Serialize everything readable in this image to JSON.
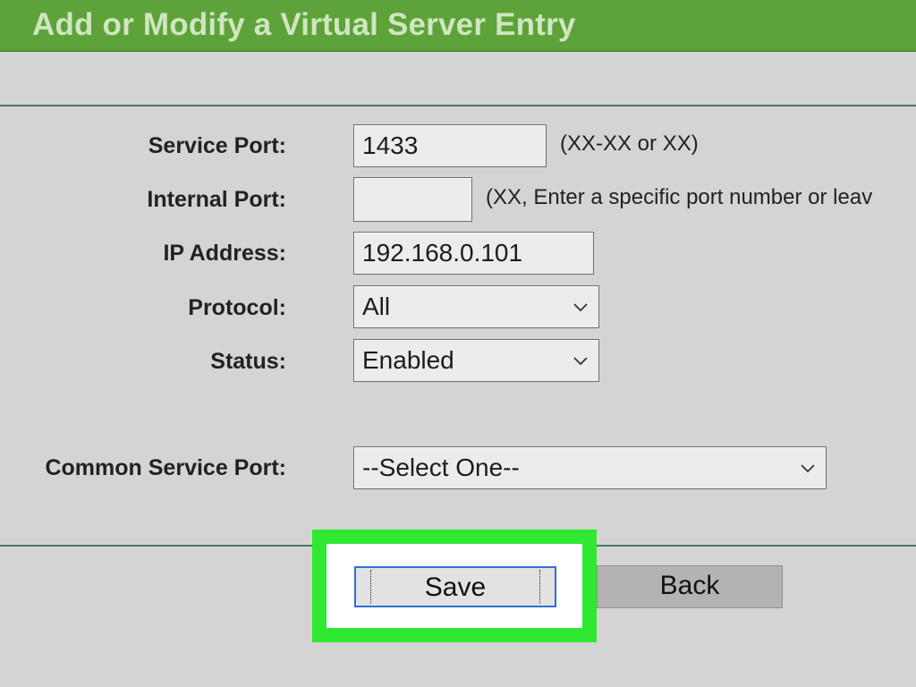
{
  "header": {
    "title": "Add or Modify a Virtual Server Entry"
  },
  "form": {
    "service_port": {
      "label": "Service Port:",
      "value": "1433",
      "hint": "(XX-XX or XX)"
    },
    "internal_port": {
      "label": "Internal Port:",
      "value": "",
      "hint": "(XX, Enter a specific port number or leav"
    },
    "ip_address": {
      "label": "IP Address:",
      "value": "192.168.0.101"
    },
    "protocol": {
      "label": "Protocol:",
      "value": "All"
    },
    "status": {
      "label": "Status:",
      "value": "Enabled"
    },
    "common_service_port": {
      "label": "Common Service Port:",
      "value": "--Select One--"
    }
  },
  "buttons": {
    "save_label": "Save",
    "back_label": "Back"
  },
  "colors": {
    "title_bar": "#5ea23a",
    "highlight": "#2ee832",
    "focus_border": "#2f6fd1"
  },
  "icons": {
    "dropdown": "chevron-down-icon"
  }
}
